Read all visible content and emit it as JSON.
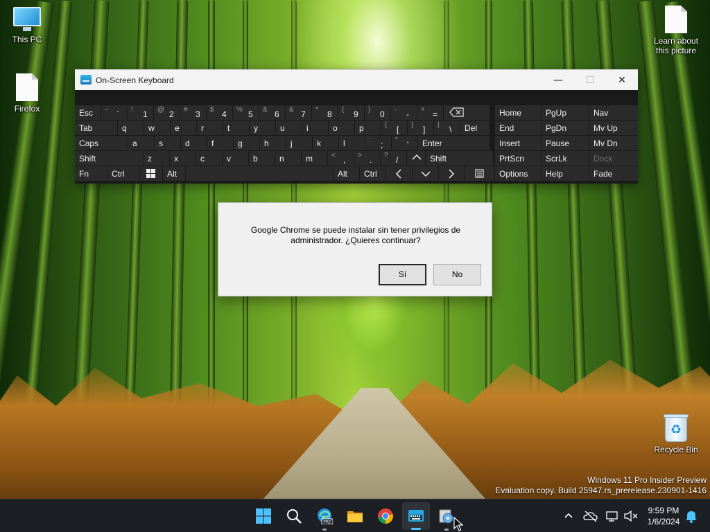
{
  "desktop": {
    "icons": [
      {
        "label": "This PC"
      },
      {
        "label": "Firefox"
      },
      {
        "label": "Learn about this picture"
      },
      {
        "label": "Recycle Bin"
      }
    ],
    "watermark": {
      "line1": "Windows 11 Pro Insider Preview",
      "line2": "Evaluation copy. Build 25947.rs_prerelease.230901-1416"
    }
  },
  "osk": {
    "title": "On-Screen Keyboard",
    "window_buttons": {
      "minimize": "—",
      "maximize": "☐",
      "close": "✕"
    },
    "row1": [
      {
        "main": "Esc"
      },
      {
        "shift": "~",
        "main": "`"
      },
      {
        "shift": "!",
        "main": "1"
      },
      {
        "shift": "@",
        "main": "2"
      },
      {
        "shift": "#",
        "main": "3"
      },
      {
        "shift": "$",
        "main": "4"
      },
      {
        "shift": "%",
        "main": "5"
      },
      {
        "shift": "&",
        "main": "6"
      },
      {
        "shift": "&",
        "main": "7"
      },
      {
        "shift": "*",
        "main": "8"
      },
      {
        "shift": "(",
        "main": "9"
      },
      {
        "shift": ")",
        "main": "0"
      },
      {
        "shift": "-",
        "main": "-"
      },
      {
        "shift": "+",
        "main": "="
      },
      {
        "icon": "backspace-icon"
      }
    ],
    "row2": [
      {
        "main": "Tab"
      },
      {
        "main": "q"
      },
      {
        "main": "w"
      },
      {
        "main": "e"
      },
      {
        "main": "r"
      },
      {
        "main": "t"
      },
      {
        "main": "y"
      },
      {
        "main": "u"
      },
      {
        "main": "i"
      },
      {
        "main": "o"
      },
      {
        "main": "p"
      },
      {
        "shift": "{",
        "main": "["
      },
      {
        "shift": "}",
        "main": "]"
      },
      {
        "shift": "|",
        "main": "\\"
      },
      {
        "main": "Del"
      }
    ],
    "row3": [
      {
        "main": "Caps"
      },
      {
        "main": "a"
      },
      {
        "main": "s"
      },
      {
        "main": "d"
      },
      {
        "main": "f"
      },
      {
        "main": "g"
      },
      {
        "main": "h"
      },
      {
        "main": "j"
      },
      {
        "main": "k"
      },
      {
        "main": "l"
      },
      {
        "shift": ":",
        "main": ";"
      },
      {
        "shift": "\"",
        "main": "'"
      },
      {
        "main": "Enter"
      }
    ],
    "row4": [
      {
        "main": "Shift"
      },
      {
        "main": "z"
      },
      {
        "main": "x"
      },
      {
        "main": "c"
      },
      {
        "main": "v"
      },
      {
        "main": "b"
      },
      {
        "main": "n"
      },
      {
        "main": "m"
      },
      {
        "shift": "<",
        "main": ","
      },
      {
        "shift": ">",
        "main": "."
      },
      {
        "shift": "?",
        "main": "/"
      },
      {
        "icon": "arrow-up-icon"
      },
      {
        "main": "Shift"
      }
    ],
    "row5": [
      {
        "main": "Fn"
      },
      {
        "main": "Ctrl"
      },
      {
        "icon": "windows-logo-icon"
      },
      {
        "main": "Alt"
      },
      {
        "main": ""
      },
      {
        "main": "Alt"
      },
      {
        "main": "Ctrl"
      },
      {
        "icon": "arrow-left-icon"
      },
      {
        "icon": "arrow-down-icon"
      },
      {
        "icon": "arrow-right-icon"
      },
      {
        "icon": "menu-icon"
      }
    ],
    "nav_keys": [
      [
        "Home",
        "PgUp",
        "Nav"
      ],
      [
        "End",
        "PgDn",
        "Mv Up"
      ],
      [
        "Insert",
        "Pause",
        "Mv Dn"
      ],
      [
        "PrtScn",
        "ScrLk",
        "Dock"
      ],
      [
        "Options",
        "Help",
        "Fade"
      ]
    ],
    "colors": {
      "key_bg": "#2b2b2b",
      "key_text": "#f0f0f0",
      "frame": "#1a1a1a"
    }
  },
  "dialog": {
    "message_line1": "Google Chrome se puede instalar sin tener privilegios de",
    "message_line2": "administrador. ¿Quieres continuar?",
    "yes_label": "Sí",
    "no_label": "No"
  },
  "taskbar": {
    "apps": [
      "windows-start-icon",
      "search-icon",
      "edge-beta-icon",
      "file-explorer-icon",
      "chrome-icon",
      "on-screen-keyboard-icon",
      "installer-icon"
    ],
    "clock": {
      "time": "9:59 PM",
      "date": "1/6/2024"
    },
    "colors": {
      "bg": "#1c1f24",
      "accent": "#4cc2ff"
    }
  }
}
